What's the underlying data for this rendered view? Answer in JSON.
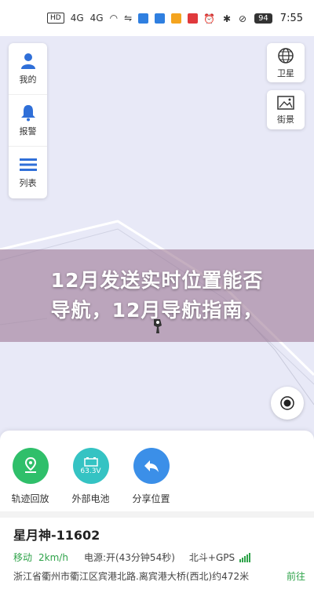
{
  "statusbar": {
    "badge_hd": "HD",
    "signal_4g_1": "4G",
    "signal_4g_2": "4G",
    "battery": "94",
    "time": "7:55"
  },
  "left_panel": {
    "items": [
      {
        "label": "我的",
        "icon": "person-icon"
      },
      {
        "label": "报警",
        "icon": "bell-icon"
      },
      {
        "label": "列表",
        "icon": "list-icon"
      }
    ]
  },
  "right_panel": {
    "satellite_label": "卫星",
    "street_label": "街景"
  },
  "banner": {
    "line1": "12月发送实时位置能否",
    "line2": "导航，12月导航指南，"
  },
  "actions": [
    {
      "label": "轨迹回放",
      "icon": "route-icon",
      "color": "#2fbf6a"
    },
    {
      "label": "外部电池",
      "icon": "battery-icon",
      "color": "#35c3c3",
      "value": "63.3V"
    },
    {
      "label": "分享位置",
      "icon": "share-icon",
      "color": "#3b8fe8"
    }
  ],
  "vehicle": {
    "name": "星月神-11602",
    "status": "移动",
    "speed": "2km/h",
    "power": "电源:开(43分钟54秒)",
    "gps": "北斗+GPS",
    "address": "浙江省衢州市衢江区宾港北路.离宾港大桥(西北)约472米",
    "goto": "前往"
  },
  "colors": {
    "accent_green": "#2fa34a",
    "map_bg": "#e8e9f7"
  }
}
